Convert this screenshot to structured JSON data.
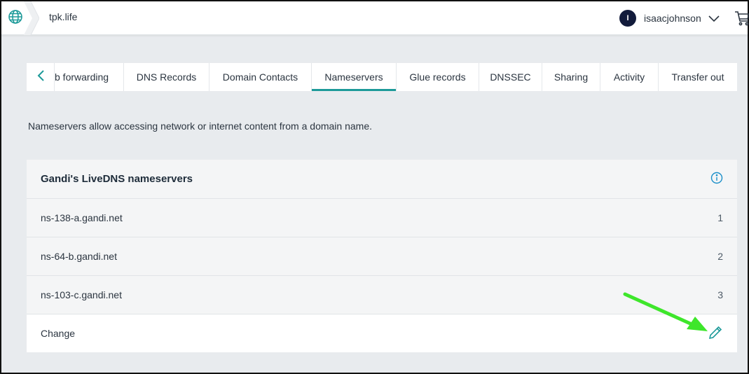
{
  "header": {
    "site_name": "tpk.life",
    "user": {
      "initial": "I",
      "name": "isaacjohnson"
    },
    "icons": [
      "globe-icon",
      "chevron-down-icon",
      "cart-icon"
    ]
  },
  "tabs": [
    {
      "label": "b forwarding",
      "active": false
    },
    {
      "label": "DNS Records",
      "active": false
    },
    {
      "label": "Domain Contacts",
      "active": false
    },
    {
      "label": "Nameservers",
      "active": true
    },
    {
      "label": "Glue records",
      "active": false
    },
    {
      "label": "DNSSEC",
      "active": false
    },
    {
      "label": "Sharing",
      "active": false
    },
    {
      "label": "Activity",
      "active": false
    },
    {
      "label": "Transfer out",
      "active": false
    }
  ],
  "description": "Nameservers allow accessing network or internet content from a domain name.",
  "nameserver_card": {
    "title": "Gandi's LiveDNS nameservers",
    "rows": [
      {
        "host": "ns-138-a.gandi.net",
        "index": "1"
      },
      {
        "host": "ns-64-b.gandi.net",
        "index": "2"
      },
      {
        "host": "ns-103-c.gandi.net",
        "index": "3"
      }
    ],
    "change_label": "Change"
  },
  "colors": {
    "accent": "#1d9a99",
    "annotation_arrow": "#3ee62b",
    "avatar_bg": "#121b3b"
  }
}
